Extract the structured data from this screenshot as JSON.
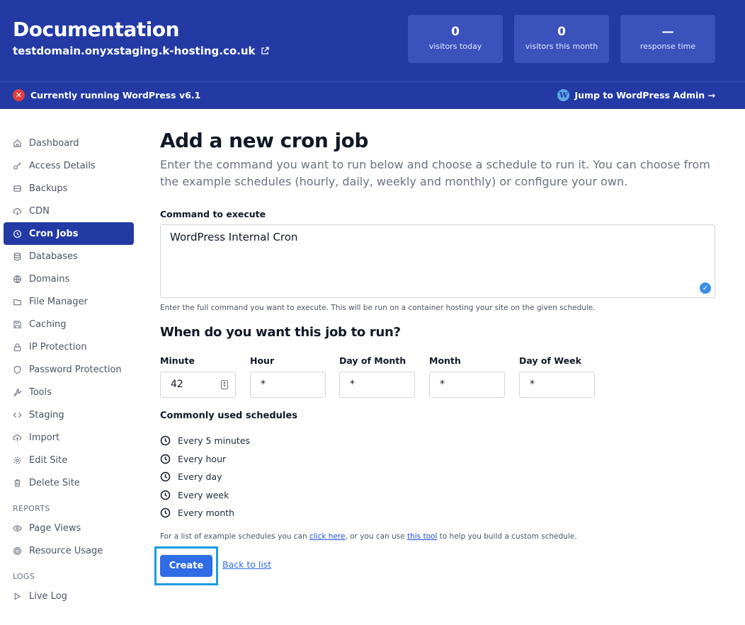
{
  "header": {
    "title": "Documentation",
    "domain": "testdomain.onyxstaging.k-hosting.co.uk",
    "stats": [
      {
        "value": "0",
        "label": "visitors today"
      },
      {
        "value": "0",
        "label": "visitors this month"
      },
      {
        "value": "—",
        "label": "response time"
      }
    ]
  },
  "wpbar": {
    "status": "Currently running WordPress v6.1",
    "admin_link": "Jump to WordPress Admin →",
    "status_icon": "x-circle-icon",
    "wp_icon": "wordpress-icon"
  },
  "sidebar": {
    "items": [
      {
        "label": "Dashboard",
        "icon": "home-icon"
      },
      {
        "label": "Access Details",
        "icon": "key-icon"
      },
      {
        "label": "Backups",
        "icon": "backup-icon"
      },
      {
        "label": "CDN",
        "icon": "cloud-icon"
      },
      {
        "label": "Cron Jobs",
        "icon": "clock-icon",
        "active": true
      },
      {
        "label": "Databases",
        "icon": "database-icon"
      },
      {
        "label": "Domains",
        "icon": "globe-icon"
      },
      {
        "label": "File Manager",
        "icon": "folder-icon"
      },
      {
        "label": "Caching",
        "icon": "save-icon"
      },
      {
        "label": "IP Protection",
        "icon": "lock-icon"
      },
      {
        "label": "Password Protection",
        "icon": "shield-icon"
      },
      {
        "label": "Tools",
        "icon": "wrench-icon"
      },
      {
        "label": "Staging",
        "icon": "code-icon"
      },
      {
        "label": "Import",
        "icon": "upload-icon"
      },
      {
        "label": "Edit Site",
        "icon": "gear-icon"
      },
      {
        "label": "Delete Site",
        "icon": "trash-icon"
      }
    ],
    "reports_label": "REPORTS",
    "reports": [
      {
        "label": "Page Views",
        "icon": "eye-icon"
      },
      {
        "label": "Resource Usage",
        "icon": "target-icon"
      }
    ],
    "logs_label": "LOGS",
    "logs": [
      {
        "label": "Live Log",
        "icon": "play-icon"
      }
    ]
  },
  "main": {
    "title": "Add a new cron job",
    "description": "Enter the command you want to run below and choose a schedule to run it. You can choose from the example schedules (hourly, daily, weekly and monthly) or configure your own.",
    "command_label": "Command to execute",
    "command_value": "WordPress Internal Cron",
    "command_help": "Enter the full command you want to execute. This will be run on a container hosting your site on the given schedule.",
    "schedule_title": "When do you want this job to run?",
    "fields": {
      "minute": {
        "label": "Minute",
        "value": "42"
      },
      "hour": {
        "label": "Hour",
        "value": "*"
      },
      "day_of_month": {
        "label": "Day of Month",
        "value": "*"
      },
      "month": {
        "label": "Month",
        "value": "*"
      },
      "day_of_week": {
        "label": "Day of Week",
        "value": "*"
      }
    },
    "common_title": "Commonly used schedules",
    "schedules": [
      "Every 5 minutes",
      "Every hour",
      "Every day",
      "Every week",
      "Every month"
    ],
    "footnote_pre": "For a list of example schedules you can ",
    "footnote_link1": "click here",
    "footnote_mid": ", or you can use ",
    "footnote_link2": "this tool",
    "footnote_post": " to help you build a custom schedule.",
    "create_label": "Create",
    "back_label": "Back to list"
  },
  "colors": {
    "brand": "#233aa5",
    "stat_bg": "#3b52bd",
    "primary_button": "#2f6ce5",
    "highlight": "#1a9be0"
  }
}
